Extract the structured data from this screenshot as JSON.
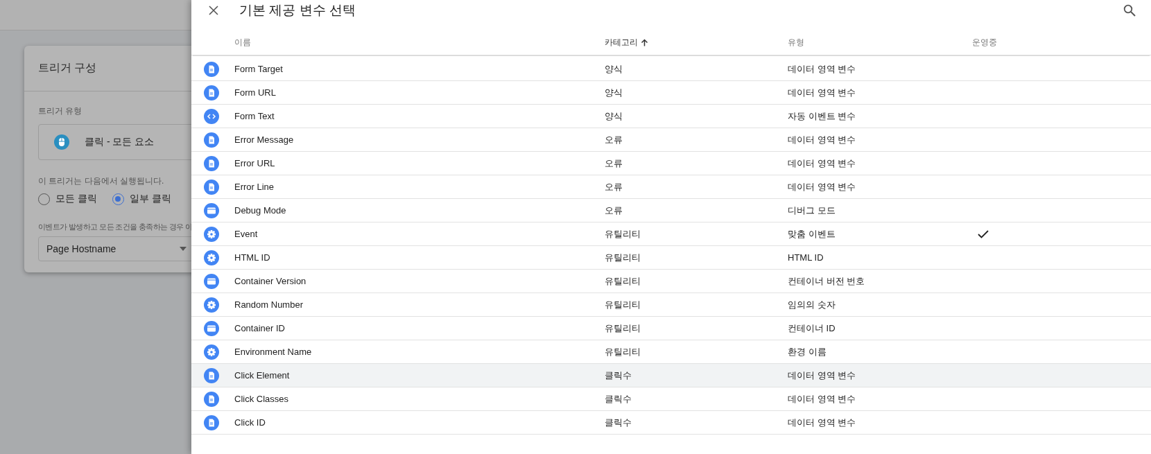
{
  "background": {
    "card": {
      "title": "트리거 구성",
      "type_label": "트리거 유형",
      "trigger_type": "클릭 - 모든 요소",
      "fires_label": "이 트리거는 다음에서 실행됩니다.",
      "options": [
        {
          "label": "모든 클릭",
          "selected": false
        },
        {
          "label": "일부 클릭",
          "selected": true
        }
      ],
      "condition_label": "이벤트가 발생하고 모든 조건을 충족하는 경우 이",
      "condition_value": "Page Hostname"
    }
  },
  "panel": {
    "title": "기본 제공 변수 선택",
    "columns": [
      {
        "label": "이름",
        "sorted": false
      },
      {
        "label": "카테고리",
        "sorted": true
      },
      {
        "label": "유형",
        "sorted": false
      },
      {
        "label": "운영중",
        "sorted": false
      }
    ],
    "rows": [
      {
        "kind": "doc",
        "name": "Form Target",
        "category": "양식",
        "type": "데이터 영역 변수",
        "live": false,
        "selected": false
      },
      {
        "kind": "doc",
        "name": "Form URL",
        "category": "양식",
        "type": "데이터 영역 변수",
        "live": false,
        "selected": false
      },
      {
        "kind": "code",
        "name": "Form Text",
        "category": "양식",
        "type": "자동 이벤트 변수",
        "live": false,
        "selected": false
      },
      {
        "kind": "doc",
        "name": "Error Message",
        "category": "오류",
        "type": "데이터 영역 변수",
        "live": false,
        "selected": false
      },
      {
        "kind": "doc",
        "name": "Error URL",
        "category": "오류",
        "type": "데이터 영역 변수",
        "live": false,
        "selected": false
      },
      {
        "kind": "doc",
        "name": "Error Line",
        "category": "오류",
        "type": "데이터 영역 변수",
        "live": false,
        "selected": false
      },
      {
        "kind": "window",
        "name": "Debug Mode",
        "category": "오류",
        "type": "디버그 모드",
        "live": false,
        "selected": false
      },
      {
        "kind": "gear",
        "name": "Event",
        "category": "유틸리티",
        "type": "맞춤 이벤트",
        "live": true,
        "selected": false
      },
      {
        "kind": "gear",
        "name": "HTML ID",
        "category": "유틸리티",
        "type": "HTML ID",
        "live": false,
        "selected": false
      },
      {
        "kind": "window",
        "name": "Container Version",
        "category": "유틸리티",
        "type": "컨테이너 버전 번호",
        "live": false,
        "selected": false
      },
      {
        "kind": "gear",
        "name": "Random Number",
        "category": "유틸리티",
        "type": "임의의 숫자",
        "live": false,
        "selected": false
      },
      {
        "kind": "window",
        "name": "Container ID",
        "category": "유틸리티",
        "type": "컨테이너 ID",
        "live": false,
        "selected": false
      },
      {
        "kind": "gear",
        "name": "Environment Name",
        "category": "유틸리티",
        "type": "환경 이름",
        "live": false,
        "selected": false
      },
      {
        "kind": "doc",
        "name": "Click Element",
        "category": "클릭수",
        "type": "데이터 영역 변수",
        "live": false,
        "selected": true
      },
      {
        "kind": "doc",
        "name": "Click Classes",
        "category": "클릭수",
        "type": "데이터 영역 변수",
        "live": false,
        "selected": false
      },
      {
        "kind": "doc",
        "name": "Click ID",
        "category": "클릭수",
        "type": "데이터 영역 변수",
        "live": false,
        "selected": false
      }
    ]
  }
}
